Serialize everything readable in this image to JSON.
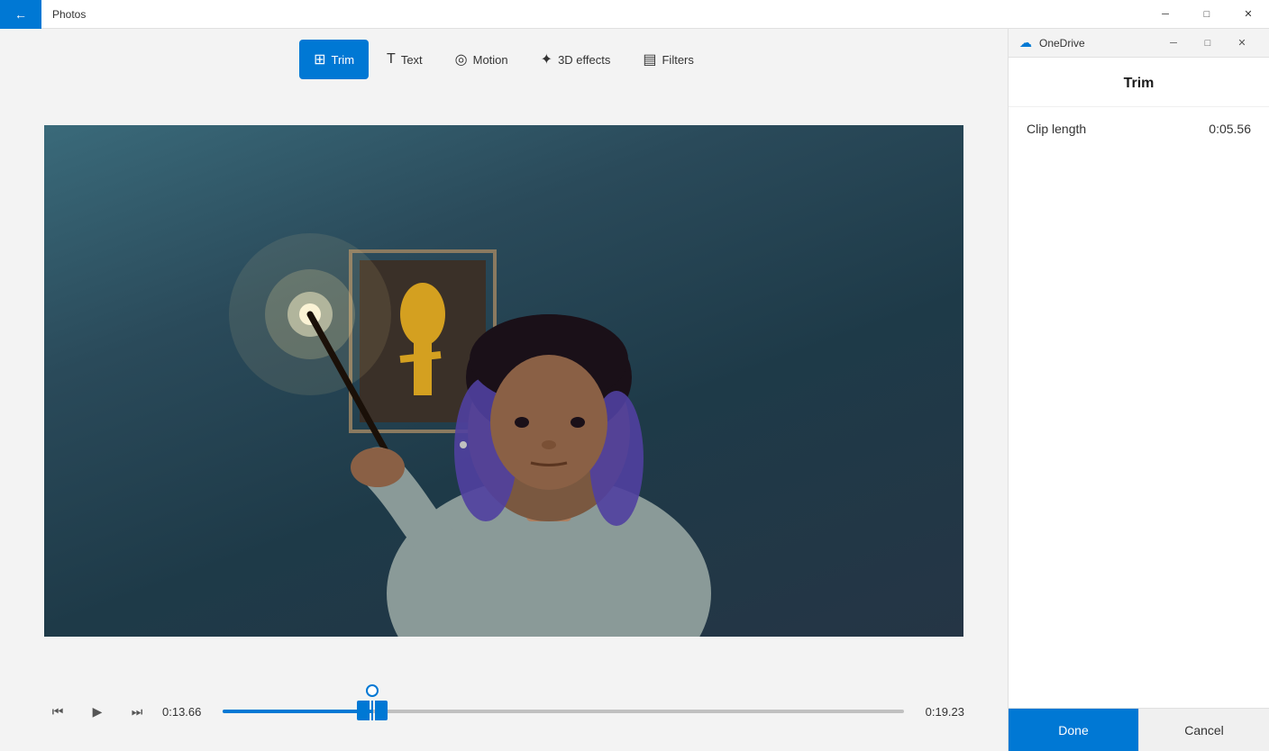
{
  "titlebar": {
    "back_label": "←",
    "title": "Photos",
    "minimize_label": "─",
    "maximize_label": "□",
    "close_label": "✕"
  },
  "toolbar": {
    "trim_label": "Trim",
    "text_label": "Text",
    "motion_label": "Motion",
    "effects_label": "3D effects",
    "filters_label": "Filters"
  },
  "controls": {
    "rewind_label": "⏮",
    "play_label": "▶",
    "forward_label": "⏭",
    "time_current": "0:13.66",
    "time_end": "0:19.23"
  },
  "right_panel": {
    "onedrive_title": "OneDrive",
    "trim_title": "Trim",
    "clip_length_label": "Clip length",
    "clip_length_value": "0:05.56",
    "done_label": "Done",
    "cancel_label": "Cancel"
  }
}
